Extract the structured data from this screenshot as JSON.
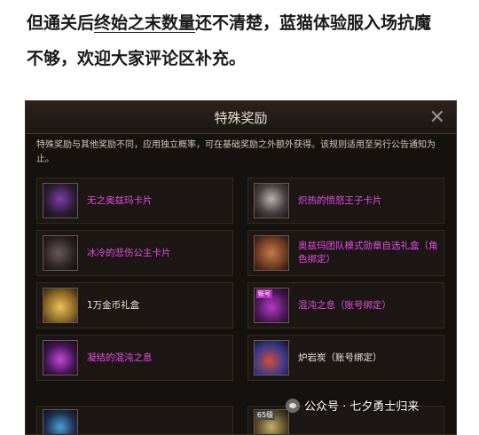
{
  "article": {
    "line1_pre": "但通关后",
    "line1_highlight": "终始之末数量",
    "line1_post": "还不清楚，蓝猫体验服入场抗魔",
    "line2": "不够，欢迎大家评论区补充。"
  },
  "dialog": {
    "title": "特殊奖励",
    "close_symbol": "✕",
    "description": "特殊奖励与其他奖励不同，应用独立概率，可在基础奖励之外额外获得。该规则适用至另行公告通知为止。",
    "rewards": [
      {
        "label": "无之奥兹玛卡片",
        "icon": "purple-card-icon",
        "color": "purple"
      },
      {
        "label": "炽热的愤怒王子卡片",
        "icon": "white-card-icon",
        "color": "purple"
      },
      {
        "label": "冰冷的悲伤公主卡片",
        "icon": "dark-card-icon",
        "color": "purple"
      },
      {
        "label": "奥兹玛团队模式勋章自选礼盒（角色绑定）",
        "icon": "chest-icon",
        "color": "purple"
      },
      {
        "label": "1万金币礼盒",
        "icon": "gold-box-icon",
        "color": "white"
      },
      {
        "label": "混沌之息（账号绑定）",
        "icon": "chaos-breath-icon",
        "color": "purple",
        "tag": "账号"
      },
      {
        "label": "凝结的混沌之息",
        "icon": "chaos-crystal-icon",
        "color": "purple"
      },
      {
        "label": "炉岩炭（账号绑定）",
        "icon": "lava-coal-icon",
        "color": "white"
      }
    ],
    "partial_badge": "65级"
  },
  "watermark": {
    "text": "公众号 · 七夕勇士归来",
    "icon": "wechat-icon"
  }
}
